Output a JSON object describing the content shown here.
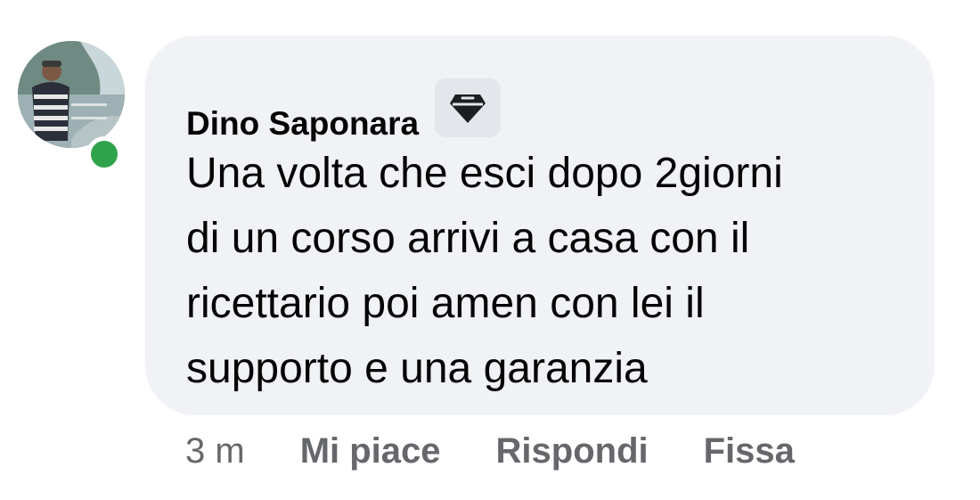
{
  "comment": {
    "author": "Dino Saponara",
    "badge_icon": "top-fan-diamond-icon",
    "text_lines": [
      "Una volta che esci dopo 2giorni",
      "di un corso arrivi a casa con il",
      "ricettario poi amen con lei il",
      "supporto e una garanzia"
    ],
    "timestamp": "3 m",
    "online": true
  },
  "actions": {
    "like": "Mi piace",
    "reply": "Rispondi",
    "pin": "Fissa"
  },
  "colors": {
    "bubble": "#f0f2f5",
    "online": "#31a24c",
    "secondary_text": "#65676b"
  }
}
